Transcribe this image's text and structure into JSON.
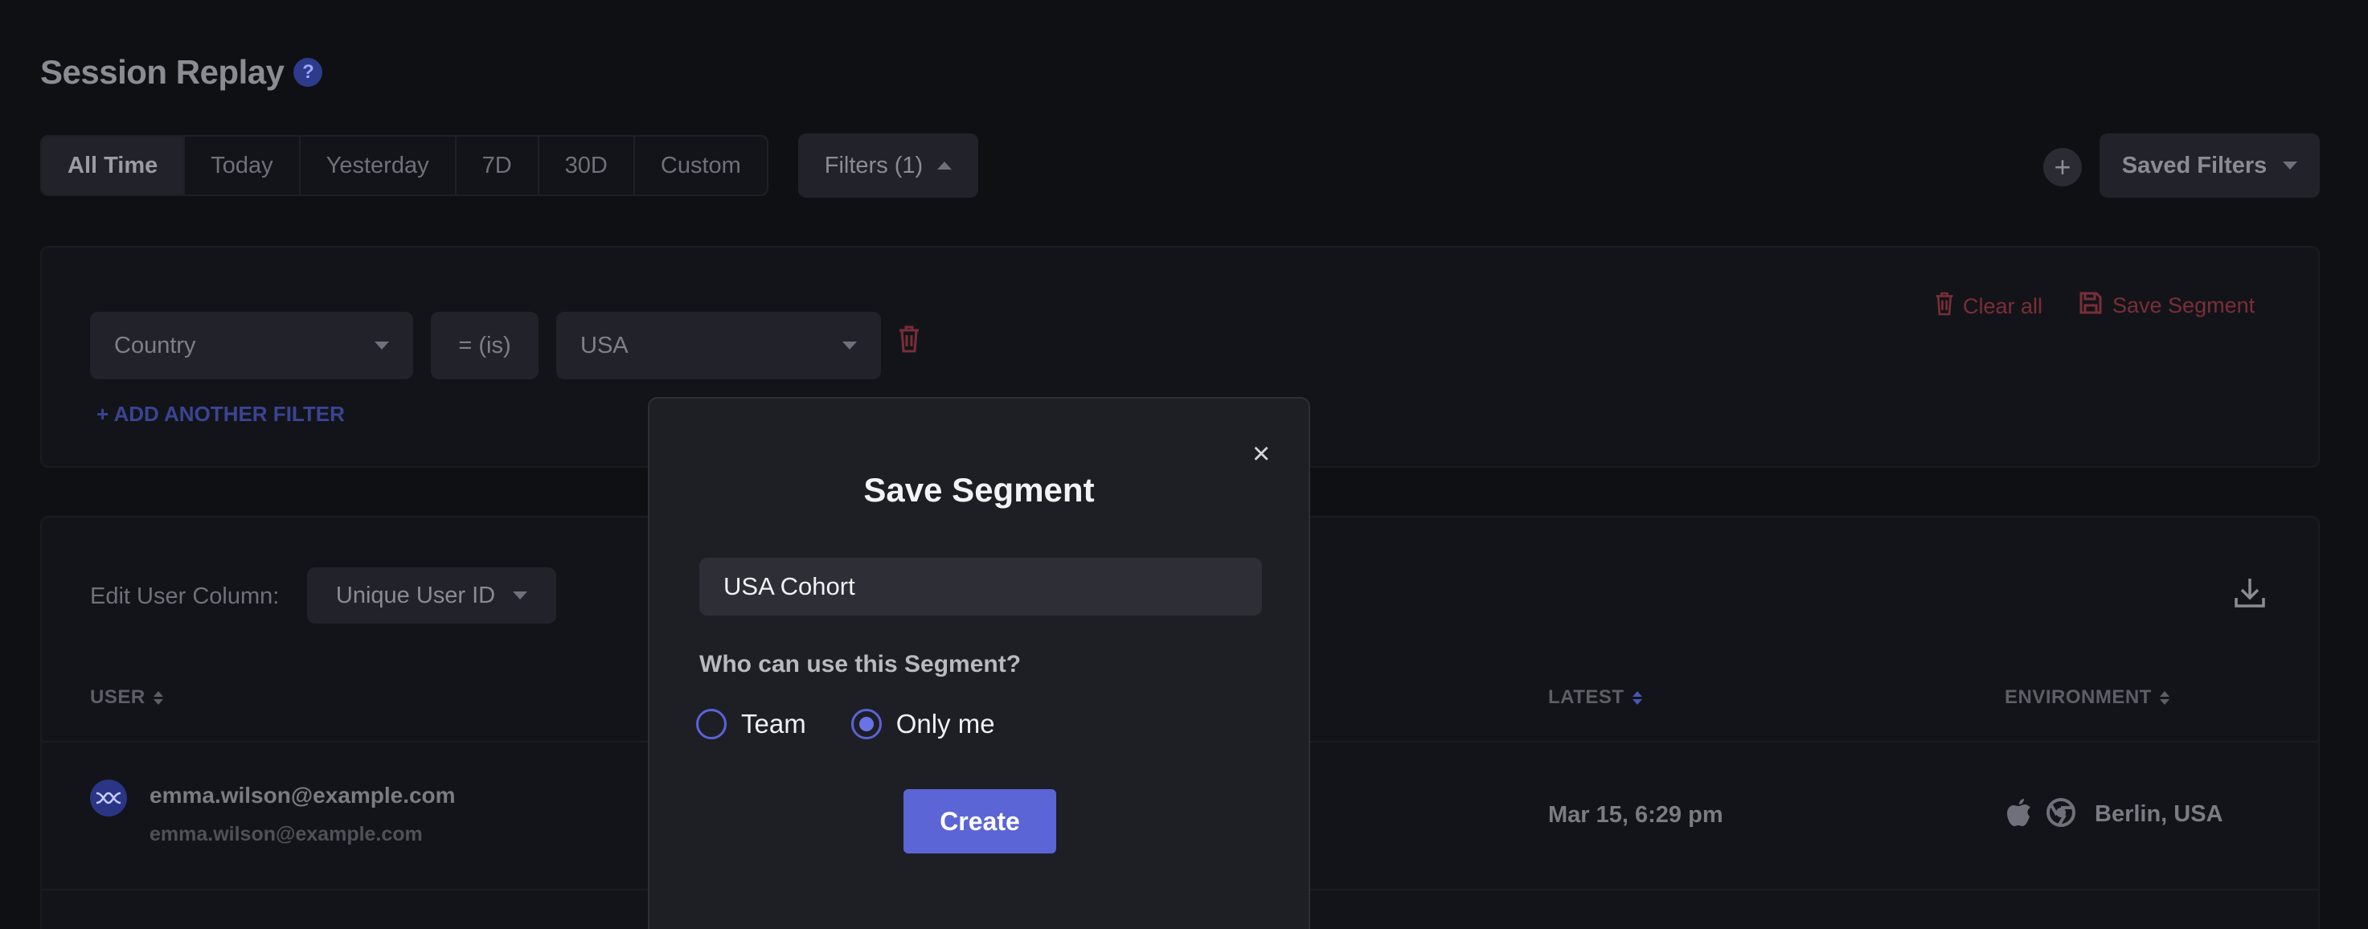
{
  "header": {
    "title": "Session Replay",
    "help": "?"
  },
  "date_range": {
    "options": [
      "All Time",
      "Today",
      "Yesterday",
      "7D",
      "30D",
      "Custom"
    ],
    "selected": "All Time"
  },
  "toolbar": {
    "filters_label": "Filters (1)",
    "add_icon": "+",
    "saved_filters_label": "Saved Filters"
  },
  "filter_panel": {
    "field": "Country",
    "operator": "= (is)",
    "value": "USA",
    "clear_all_label": "Clear all",
    "save_segment_label": "Save Segment",
    "add_filter_label": "+ ADD ANOTHER FILTER"
  },
  "table": {
    "edit_column_label": "Edit User Column:",
    "user_column_value": "Unique User ID",
    "columns": {
      "user": "USER",
      "latest": "LATEST",
      "environment": "ENVIRONMENT"
    },
    "rows": [
      {
        "user": "emma.wilson@example.com",
        "user_sub": "emma.wilson@example.com",
        "latest": "Mar 15, 6:29 pm",
        "environment": "Berlin, USA"
      }
    ]
  },
  "modal": {
    "title": "Save Segment",
    "close_icon": "×",
    "input_value": "USA Cohort",
    "question": "Who can use this Segment?",
    "options": [
      "Team",
      "Only me"
    ],
    "selected_option": "Only me",
    "create_label": "Create"
  },
  "colors": {
    "accent": "#5b65d6",
    "danger": "#7a2e38",
    "background": "#0f1014"
  }
}
